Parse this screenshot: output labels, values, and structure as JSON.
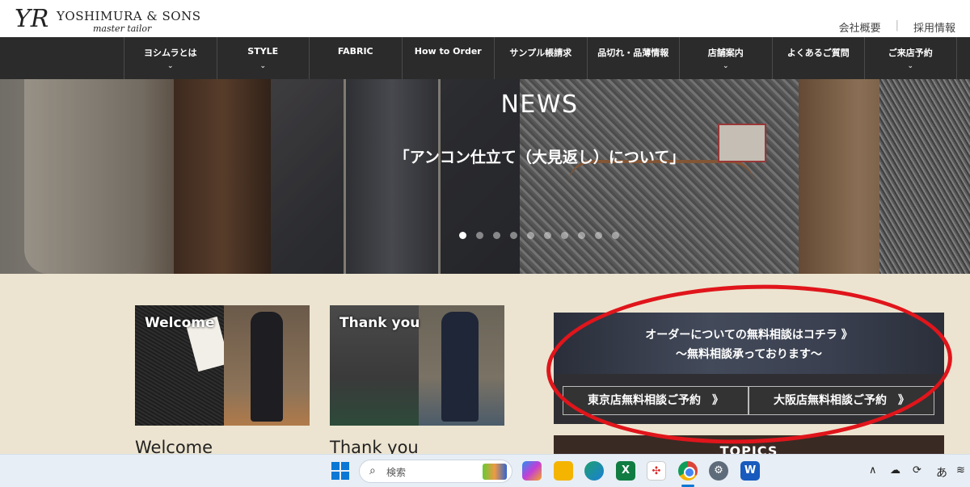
{
  "brand": {
    "mark": "YR",
    "name": "YOSHIMURA & SONS",
    "tagline": "master tailor"
  },
  "util_links": [
    "会社概要",
    "採用情報"
  ],
  "nav": [
    {
      "label": "ヨシムラとは",
      "chevron": true
    },
    {
      "label": "STYLE",
      "chevron": true
    },
    {
      "label": "FABRIC",
      "chevron": false
    },
    {
      "label": "How to Order",
      "chevron": false
    },
    {
      "label": "サンプル帳請求",
      "chevron": false
    },
    {
      "label": "品切れ・品薄情報",
      "chevron": false
    },
    {
      "label": "店舗案内",
      "chevron": true
    },
    {
      "label": "よくあるご質問",
      "chevron": false
    },
    {
      "label": "ご来店予約",
      "chevron": true
    }
  ],
  "hero": {
    "kicker": "NEWS",
    "title": "「アンコン仕立て（大見返し）について」",
    "slide_count": 10,
    "active_slide": 1
  },
  "cards": [
    {
      "overlay": "Welcome",
      "caption": "Welcome"
    },
    {
      "overlay": "Thank you",
      "caption": "Thank you"
    }
  ],
  "consult": {
    "line1": "オーダーについての無料相談はコチラ 》",
    "line2": "〜無料相談承っております〜",
    "tokyo_button": "東京店無料相談ご予約　》",
    "osaka_button": "大阪店無料相談ご予約　》"
  },
  "topics": {
    "label": "TOPICS"
  },
  "annotation": {
    "color": "#e0151b"
  },
  "taskbar": {
    "search_placeholder": "検索",
    "search_glyph": "⌕",
    "icons": [
      "copilot-icon",
      "file-explorer-icon",
      "edge-icon",
      "excel-icon",
      "app-icon",
      "chrome-icon",
      "settings-icon",
      "word-icon"
    ],
    "tray": {
      "up": "∧",
      "cloud": "☁",
      "sync": "⟳",
      "ime": "あ",
      "wifi": "≋"
    }
  },
  "colors": {
    "nav_bg": "#2b2b2b",
    "page_bg": "#ece4d0",
    "taskbar_bg": "#e8eef5"
  }
}
